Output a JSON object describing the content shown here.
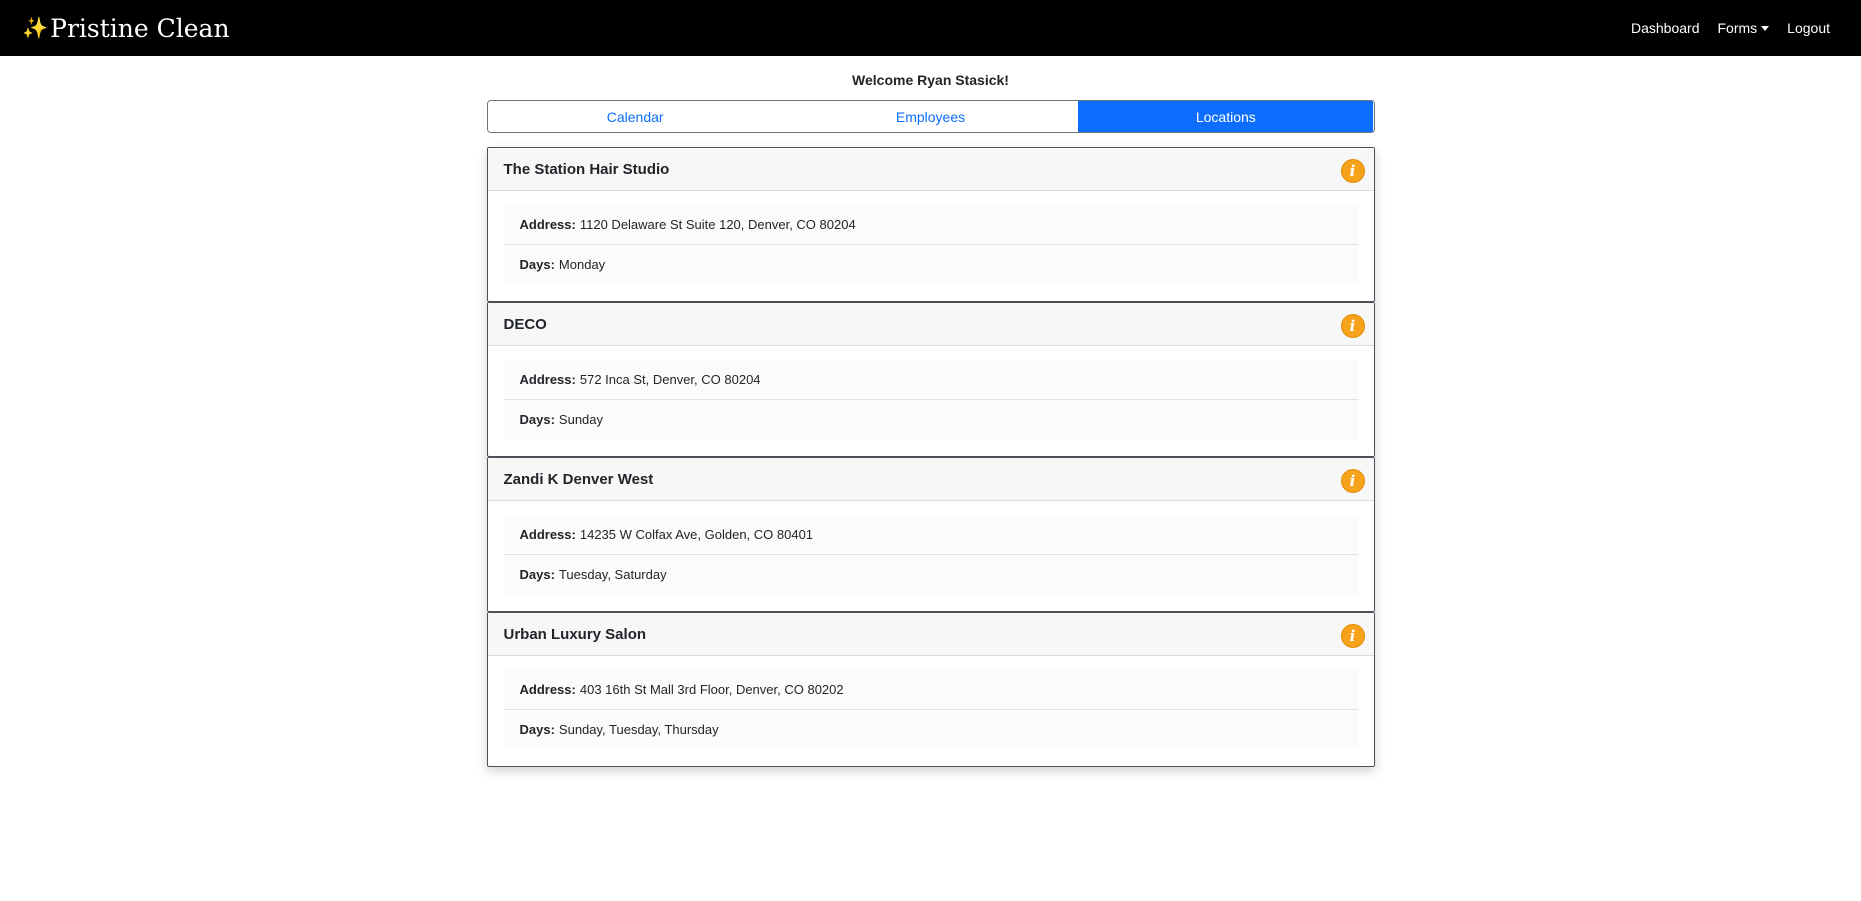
{
  "brand": {
    "icon": "sparkles-icon",
    "name": "Pristine Clean"
  },
  "nav": {
    "dashboard": "Dashboard",
    "forms": "Forms",
    "logout": "Logout"
  },
  "welcome": "Welcome Ryan Stasick!",
  "tabs": [
    {
      "label": "Calendar",
      "active": false
    },
    {
      "label": "Employees",
      "active": false
    },
    {
      "label": "Locations",
      "active": true
    }
  ],
  "labels": {
    "address": "Address:",
    "days": "Days:"
  },
  "locations": [
    {
      "name": "The Station Hair Studio",
      "address": "1120 Delaware St Suite 120, Denver, CO 80204",
      "days": "Monday"
    },
    {
      "name": "DECO",
      "address": "572 Inca St, Denver, CO 80204",
      "days": "Sunday"
    },
    {
      "name": "Zandi K Denver West",
      "address": "14235 W Colfax Ave, Golden, CO 80401",
      "days": "Tuesday, Saturday"
    },
    {
      "name": "Urban Luxury Salon",
      "address": "403 16th St Mall 3rd Floor, Denver, CO 80202",
      "days": "Sunday, Tuesday, Thursday"
    }
  ],
  "colors": {
    "accent": "#0d6efd",
    "info": "#f7a21b",
    "navbar": "#000000"
  }
}
